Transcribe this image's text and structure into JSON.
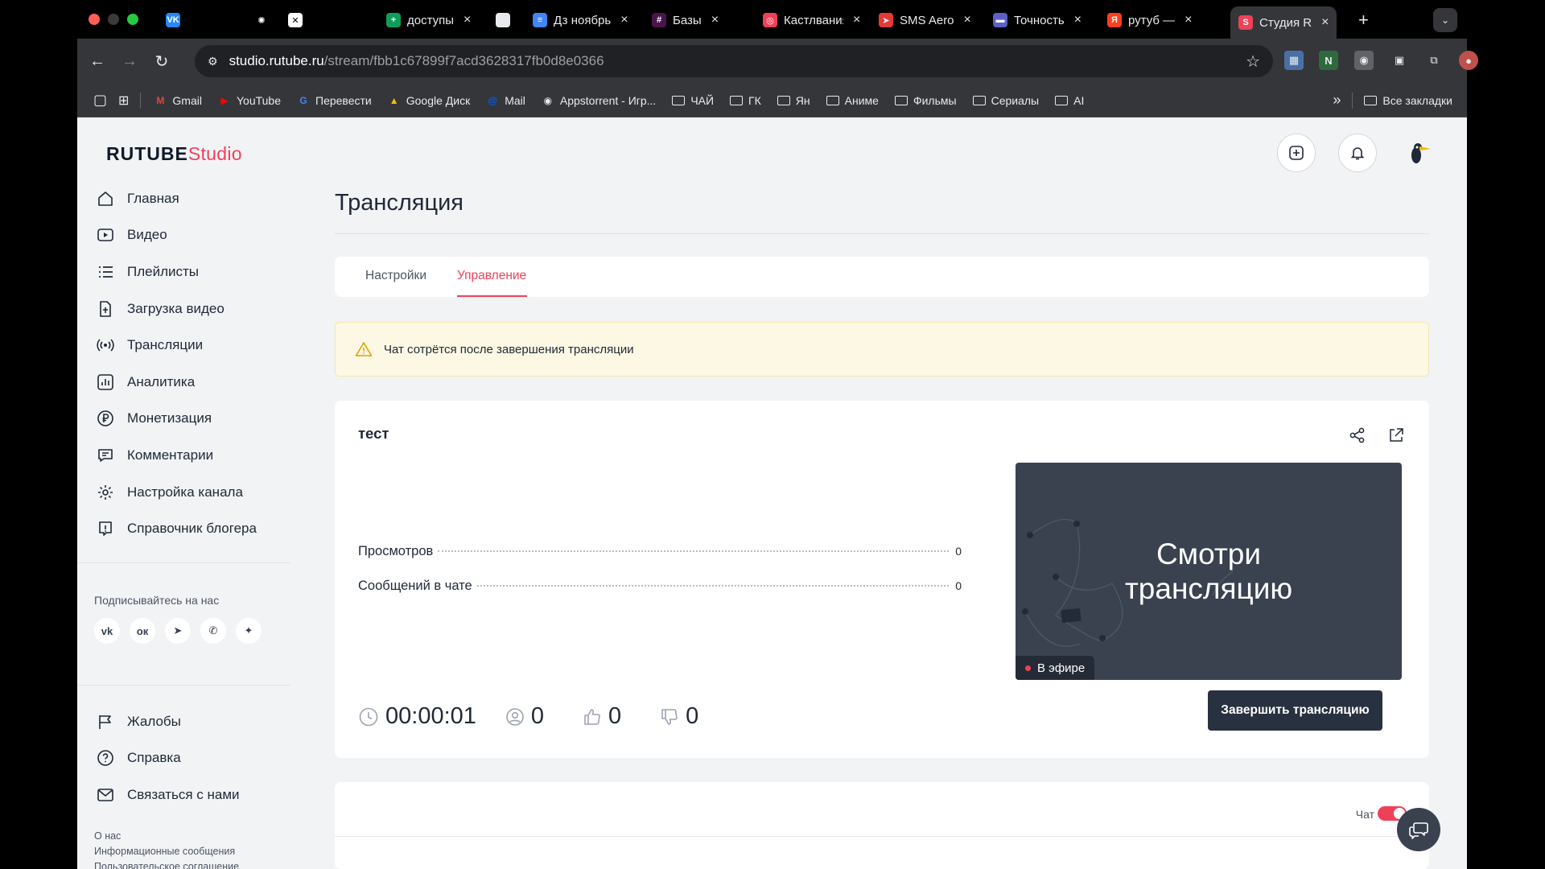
{
  "browser": {
    "tabs": [
      {
        "title": "",
        "icon": "vk-icon",
        "color": "#2787f5",
        "glyph": "VK"
      },
      {
        "title": "",
        "icon": "chatgpt-icon",
        "color": "#000000",
        "glyph": "✺"
      },
      {
        "title": "",
        "icon": "x-icon",
        "color": "#ffffff",
        "glyph": "✕"
      },
      {
        "title": "доступы",
        "icon": "sheets-icon",
        "color": "#0f9d58",
        "glyph": "+"
      },
      {
        "title": "",
        "icon": "blank-tab-icon",
        "color": "#e8eaed",
        "glyph": ""
      },
      {
        "title": "Дз ноябрь",
        "icon": "docs-icon",
        "color": "#4285f4",
        "glyph": "≡"
      },
      {
        "title": "Базы",
        "icon": "slack-icon",
        "color": "#4a154b",
        "glyph": "#"
      },
      {
        "title": "Кастлвания",
        "icon": "crunchyroll-icon",
        "color": "#ee4158",
        "glyph": "◎"
      },
      {
        "title": "SMS Aero",
        "icon": "sms-aero-icon",
        "color": "#e53935",
        "glyph": "➤"
      },
      {
        "title": "Точность",
        "icon": "tochka-icon",
        "color": "#5b5fc7",
        "glyph": "▬"
      },
      {
        "title": "рутуб —",
        "icon": "yandex-icon",
        "color": "#fc3f1d",
        "glyph": "Я"
      },
      {
        "title": "Студия R",
        "icon": "rutube-studio-icon",
        "color": "#ee4158",
        "glyph": "S"
      }
    ],
    "url_host": "studio.rutube.ru",
    "url_path": "/stream/fbb1c67899f7acd3628317fb0d8e0366",
    "bookmarks": [
      {
        "label": "Gmail",
        "icon": "gmail-icon",
        "glyph": "M",
        "color": "#ea4335"
      },
      {
        "label": "YouTube",
        "icon": "youtube-icon",
        "glyph": "▶",
        "color": "#ff0000"
      },
      {
        "label": "Перевести",
        "icon": "translate-icon",
        "glyph": "G",
        "color": "#4285f4"
      },
      {
        "label": "Google Диск",
        "icon": "google-drive-icon",
        "glyph": "▲",
        "color": "#fbbc04"
      },
      {
        "label": "Mail",
        "icon": "mail-ru-icon",
        "glyph": "@",
        "color": "#005ff9"
      },
      {
        "label": "Appstorrent - Игр...",
        "icon": "appstorrent-icon",
        "glyph": "◉",
        "color": "#e8eaed"
      },
      {
        "label": "ЧАЙ",
        "icon": "folder-icon",
        "glyph": "",
        "color": ""
      },
      {
        "label": "ГК",
        "icon": "folder-icon",
        "glyph": "",
        "color": ""
      },
      {
        "label": "Ян",
        "icon": "folder-icon",
        "glyph": "",
        "color": ""
      },
      {
        "label": "Аниме",
        "icon": "folder-icon",
        "glyph": "",
        "color": ""
      },
      {
        "label": "Фильмы",
        "icon": "folder-icon",
        "glyph": "",
        "color": ""
      },
      {
        "label": "Сериалы",
        "icon": "folder-icon",
        "glyph": "",
        "color": ""
      },
      {
        "label": "AI",
        "icon": "folder-icon",
        "glyph": "",
        "color": ""
      }
    ],
    "all_bookmarks": "Все закладки"
  },
  "logo": {
    "brand": "RUTUBE",
    "studio": "Studio"
  },
  "sidebar": {
    "items": [
      {
        "label": "Главная",
        "icon": "home-icon"
      },
      {
        "label": "Видео",
        "icon": "video-icon"
      },
      {
        "label": "Плейлисты",
        "icon": "playlist-icon"
      },
      {
        "label": "Загрузка видео",
        "icon": "upload-icon"
      },
      {
        "label": "Трансляции",
        "icon": "broadcast-icon"
      },
      {
        "label": "Аналитика",
        "icon": "analytics-icon"
      },
      {
        "label": "Монетизация",
        "icon": "ruble-icon"
      },
      {
        "label": "Комментарии",
        "icon": "comment-icon"
      },
      {
        "label": "Настройка канала",
        "icon": "gear-icon"
      },
      {
        "label": "Справочник блогера",
        "icon": "info-icon"
      }
    ],
    "follow_label": "Подписывайтесь на нас",
    "socials": [
      {
        "icon": "vk-icon",
        "glyph": "vk"
      },
      {
        "icon": "odnoklassniki-icon",
        "glyph": "ок"
      },
      {
        "icon": "telegram-icon",
        "glyph": "➤"
      },
      {
        "icon": "viber-icon",
        "glyph": "✆"
      },
      {
        "icon": "dzen-icon",
        "glyph": "✦"
      }
    ],
    "bottom_items": [
      {
        "label": "Жалобы",
        "icon": "flag-icon"
      },
      {
        "label": "Справка",
        "icon": "help-icon"
      },
      {
        "label": "Связаться с нами",
        "icon": "mail-icon"
      }
    ],
    "footer_links": [
      "О нас",
      "Информационные сообщения",
      "Пользовательское соглашение"
    ]
  },
  "page": {
    "title": "Трансляция",
    "tabs": [
      {
        "label": "Настройки",
        "active": false
      },
      {
        "label": "Управление",
        "active": true
      }
    ],
    "alert": "Чат сотрётся после завершения трансляции",
    "stream": {
      "name": "тест",
      "stats": [
        {
          "label": "Просмотров",
          "value": "0"
        },
        {
          "label": "Сообщений в чате",
          "value": "0"
        }
      ],
      "preview_text_line1": "Смотри",
      "preview_text_line2": "трансляцию",
      "live_label": "В эфире",
      "duration": "00:00:01",
      "viewers": "0",
      "likes": "0",
      "dislikes": "0",
      "end_button": "Завершить трансляцию"
    },
    "chat_label": "Чат",
    "chat_enabled": true
  },
  "colors": {
    "accent": "#ee4158",
    "dark": "#283140",
    "alert_bg": "#fdf8e4"
  }
}
